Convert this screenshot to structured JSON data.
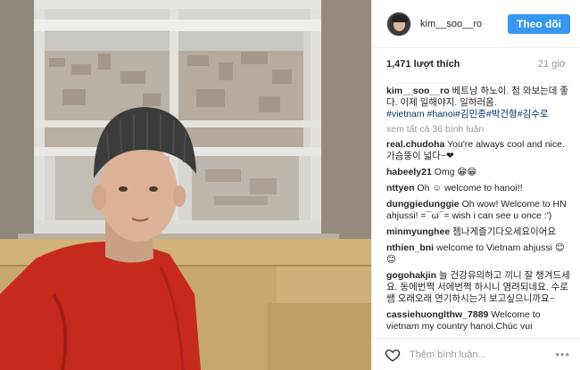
{
  "post": {
    "username": "kim__soo__ro",
    "follow_label": "Theo dõi",
    "likes": "1,471 lượt thích",
    "time_ago": "21 giờ",
    "caption": {
      "user": "kim__soo__ro",
      "text": " 베트남 하노이. 첨 와보는데 좋다. 이제 일해야지. 일하러옴.",
      "tags": "#vietnam #hanoi#김민종#박건형#김수로"
    },
    "view_all_comments": "xem tất cả 36 bình luận",
    "comments": [
      {
        "user": "real.chudoha",
        "text": " You're always cool and nice. 가슴뚱이 넓다~❤"
      },
      {
        "user": "habeely21",
        "text": " Omg 😁😁"
      },
      {
        "user": "nttyen",
        "text": " Oh ☺ welcome to hanoi!!"
      },
      {
        "user": "dunggiedunggie",
        "text": " Oh wow! Welcome to HN ahjussi! =¯ω¯= wish i can see u once :')"
      },
      {
        "user": "minmyunghee",
        "text": " 젬나게즐기다오세요이어요"
      },
      {
        "user": "nthien_bni",
        "text": " welcome to Vietnam ahjussi 😊😊"
      },
      {
        "user": "gogohakjin",
        "text": " 늘 건강유의하고 끼니 잘 챙겨드세요. 동에번쩍 서에번쩍 하시니 염려되네요. 수로쌤 오래오래 연기하시는거 보고싶으니까요~"
      },
      {
        "user": "cassiehuonglthw_7889",
        "text": " Welcome to vietnam my country hanoi.Chúc vui vẻ~~~~~"
      }
    ],
    "comment_placeholder": "Thêm bình luận...",
    "more_label": "•••",
    "icons": {
      "avatar": "profile-avatar",
      "like": "heart-outline-icon",
      "more": "more-options-icon"
    },
    "colors": {
      "follow_button": "#3897f0",
      "hashtag": "#003569"
    }
  }
}
